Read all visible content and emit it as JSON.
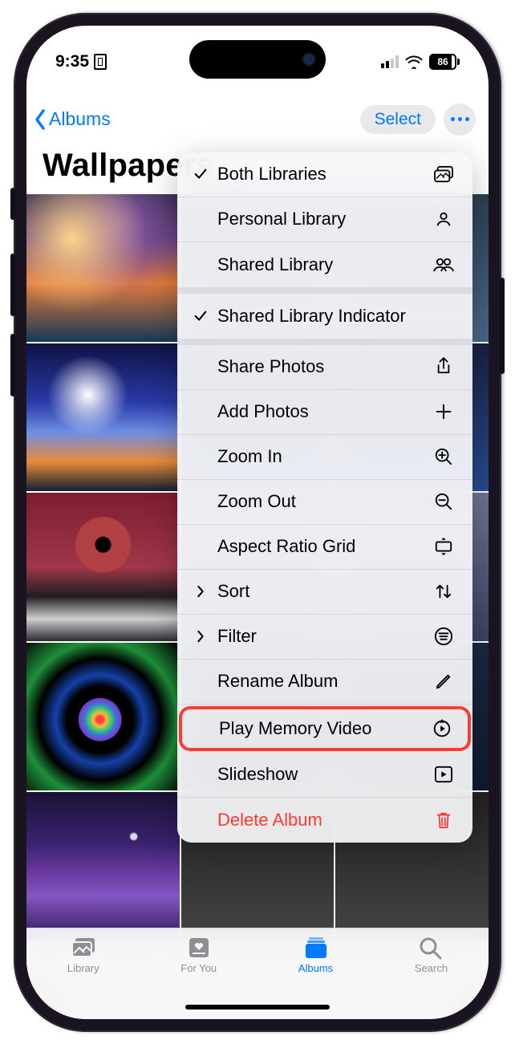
{
  "status": {
    "time": "9:35",
    "battery": "86"
  },
  "nav": {
    "back_label": "Albums",
    "select_label": "Select"
  },
  "title": "Wallpapers",
  "menu": {
    "g1": [
      {
        "label": "Both Libraries",
        "checked": true,
        "icon": "stack"
      },
      {
        "label": "Personal Library",
        "checked": false,
        "icon": "person"
      },
      {
        "label": "Shared Library",
        "checked": false,
        "icon": "people"
      }
    ],
    "g2": [
      {
        "label": "Shared Library Indicator",
        "checked": true
      }
    ],
    "g3": [
      {
        "label": "Share Photos",
        "icon": "share"
      },
      {
        "label": "Add Photos",
        "icon": "plus"
      },
      {
        "label": "Zoom In",
        "icon": "zoomin"
      },
      {
        "label": "Zoom Out",
        "icon": "zoomout"
      },
      {
        "label": "Aspect Ratio Grid",
        "icon": "aspect"
      },
      {
        "label": "Sort",
        "lead": "chev",
        "icon": "updown"
      },
      {
        "label": "Filter",
        "lead": "chev",
        "icon": "filter"
      },
      {
        "label": "Rename Album",
        "icon": "pencil"
      },
      {
        "label": "Play Memory Video",
        "icon": "memory",
        "highlight": true
      },
      {
        "label": "Slideshow",
        "icon": "play"
      },
      {
        "label": "Delete Album",
        "icon": "trash",
        "destructive": true
      }
    ]
  },
  "tabs": {
    "library": "Library",
    "foryou": "For You",
    "albums": "Albums",
    "search": "Search"
  }
}
